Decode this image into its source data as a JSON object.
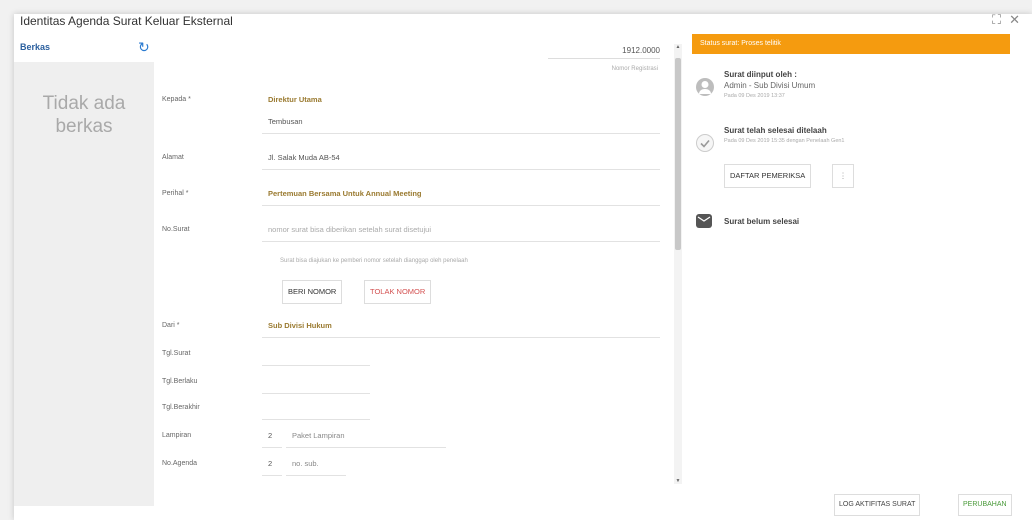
{
  "dialog": {
    "title": "Identitas Agenda Surat Keluar Eksternal"
  },
  "window": {
    "expand_icon": "expand-icon",
    "close_icon": "close-icon"
  },
  "files": {
    "label": "Berkas",
    "empty_line1": "Tidak ada",
    "empty_line2": "berkas"
  },
  "form": {
    "reg_number": "1912.0000",
    "reg_label": "Nomor Registrasi",
    "kepada_label": "Kepada *",
    "kepada_value": "Direktur Utama",
    "tembusan_value": "Tembusan",
    "alamat_label": "Alamat",
    "alamat_value": "Jl. Salak Muda AB-54",
    "perihal_label": "Perihal *",
    "perihal_value": "Pertemuan Bersama Untuk Annual Meeting",
    "nosurat_label": "No.Surat",
    "nosurat_placeholder": "nomor surat bisa diberikan setelah surat disetujui",
    "nosurat_hint": "Surat bisa diajukan ke pemberi nomor setelah dianggap oleh penelaah",
    "beri_nomor": "BERI NOMOR",
    "tolak_nomor": "TOLAK NOMOR",
    "dari_label": "Dari *",
    "dari_value": "Sub Divisi Hukum",
    "tglsurat_label": "Tgl.Surat",
    "tglberlaku_label": "Tgl.Berlaku",
    "tglberakhir_label": "Tgl.Berakhir",
    "lampiran_label": "Lampiran",
    "lampiran_num": "2",
    "lampiran_type": "Paket Lampiran",
    "agenda_label": "No.Agenda",
    "agenda_num": "2",
    "agenda_sub": "no. sub."
  },
  "status": {
    "bar": "Status surat: Proses telitik",
    "step1_title": "Surat diinput oleh :",
    "step1_user": "Admin - Sub Divisi Umum",
    "step1_time": "Pada 09 Des 2019 13:37",
    "step2_title": "Surat telah selesai ditelaah",
    "step2_time": "Pada 09 Des 2019 15:35 dengan Penelaah Gen1",
    "daftar_pemeriksa": "DAFTAR PEMERIKSA",
    "step3_title": "Surat belum selesai"
  },
  "footer": {
    "log": "LOG AKTIFITAS SURAT",
    "perubahan": "PERUBAHAN"
  },
  "colors": {
    "status_orange": "#f59b0f",
    "accent_blue": "#2a7ad0",
    "value_gold": "#9a7a30",
    "reject_red": "#d35050"
  }
}
